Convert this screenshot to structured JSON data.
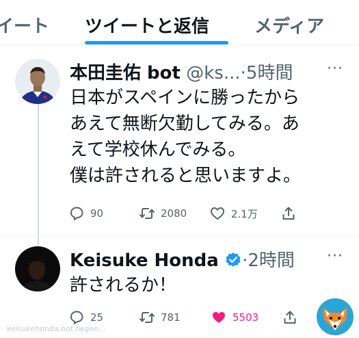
{
  "tabs": {
    "left": "イート",
    "active": "ツイートと返信",
    "right": "メディア"
  },
  "tweet1": {
    "name": "本田圭佑 bot",
    "handle": "@ks...",
    "time": "·5時間",
    "lines": [
      "日本がスペインに勝ったから",
      "あえて無断欠勤してみる。あ",
      "えて学校休んでみる。",
      "僕は許されると思いますよ。"
    ],
    "replies": "90",
    "retweets": "2080",
    "likes": "2.1万"
  },
  "tweet2": {
    "name": "Keisuke Honda",
    "time": "·2時間",
    "lines": [
      "許されるか！"
    ],
    "replies": "25",
    "retweets": "781",
    "likes": "5503"
  },
  "watermark": "keisukehonda.bot.fwgee..."
}
